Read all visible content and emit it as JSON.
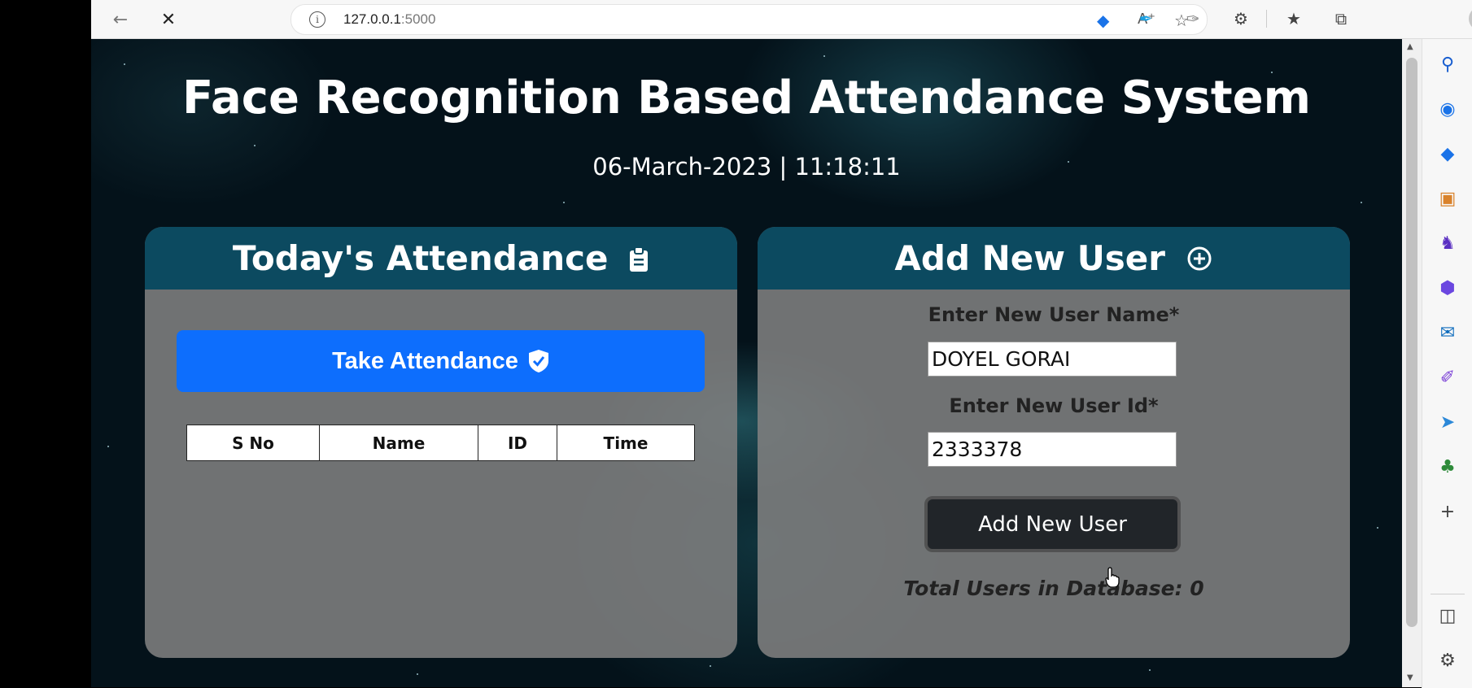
{
  "browser": {
    "url_host": "127.0.0.1",
    "url_port": ":5000"
  },
  "page": {
    "title": "Face Recognition Based Attendance System",
    "datetime": "06-March-2023 | 11:18:11"
  },
  "attendance": {
    "heading": "Today's Attendance",
    "take_button": "Take Attendance",
    "columns": [
      "S No",
      "Name",
      "ID",
      "Time"
    ]
  },
  "add_user": {
    "heading": "Add New User",
    "name_label": "Enter New User Name*",
    "name_value": "DOYEL GORAI",
    "id_label": "Enter New User Id*",
    "id_value": "2333378",
    "button": "Add New User",
    "total_text": "Total Users in Database: 0"
  },
  "colors": {
    "card_header": "#0c4a60",
    "primary_button": "#0d6efd",
    "dark_button": "#212529"
  }
}
